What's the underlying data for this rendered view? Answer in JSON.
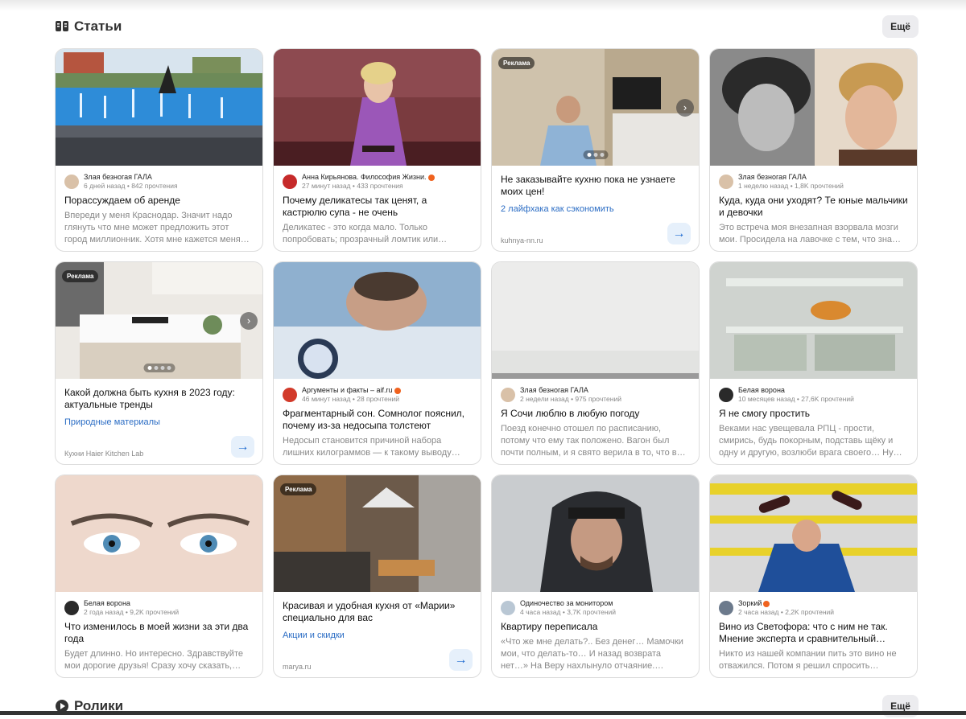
{
  "articles_section": {
    "title": "Статьи",
    "more_label": "Ещё"
  },
  "videos_section": {
    "title": "Ролики",
    "more_label": "Ещё"
  },
  "cards": [
    {
      "author": "Злая безногая ГАЛА",
      "stats": "6 дней назад • 842 прочтения",
      "title": "Порассуждаем об аренде",
      "snippet": "Впереди у меня Краснодар. Значит надо глянуть что мне может предложить этот город миллионник. Хотя мне кажется меня…"
    },
    {
      "author": "Анна Кирьянова. Философия Жизни.",
      "stats": "27 минут назад • 433 прочтения",
      "title": "Почему деликатесы так ценят, а кастрюлю супа - не очень",
      "snippet": "Деликатес - это когда мало. Только попробовать; прозрачный ломтик или…"
    },
    {
      "badge": "Реклама",
      "title": "Не заказывайте кухню пока не узнаете моих цен!",
      "link": "2 лайфхака как сэкономить",
      "domain": "kuhnya-nn.ru"
    },
    {
      "author": "Злая безногая ГАЛА",
      "stats": "1 неделю назад • 1,8K прочтений",
      "title": "Куда, куда они уходят? Те юные мальчики и девочки",
      "snippet": "Это встреча моя внезапная взорвала мозги мои. Просидела на лавочке с тем, что зна…"
    },
    {
      "badge": "Реклама",
      "title": "Какой должна быть кухня в 2023 году: актуальные тренды",
      "link": "Природные материалы",
      "domain": "Кухни Haier Kitchen Lab"
    },
    {
      "author": "Аргументы и факты – aif.ru",
      "stats": "46 минут назад • 28 прочтений",
      "title": "Фрагментарный сон. Сомнолог пояснил, почему из-за недосыпа толстеют",
      "snippet": "Недосып становится причиной набора лишних килограммов — к такому выводу…"
    },
    {
      "author": "Злая безногая ГАЛА",
      "stats": "2 недели назад • 975 прочтений",
      "title": "Я Сочи люблю в любую погоду",
      "snippet": "Поезд конечно отошел по расписанию, потому что ему так положено. Вагон был почти полным, и я свято верила в то, что в…"
    },
    {
      "author": "Белая ворона",
      "stats": "10 месяцев назад • 27,6K прочтений",
      "title": "Я не смогу простить",
      "snippet": "Веками нас увещевала РПЦ - прости, смирись, будь покорным, подставь щёку и одну и другую, возлюби врага своего… Ну…"
    },
    {
      "author": "Белая ворона",
      "stats": "2 года назад • 9,2K прочтений",
      "title": "Что изменилось в моей жизни за эти два года",
      "snippet": "Будет длинно. Но интересно. Здравствуйте мои дорогие друзья! Сразу хочу сказать, что…"
    },
    {
      "badge": "Реклама",
      "title": "Красивая и удобная кухня от «Марии» специально для вас",
      "link": "Акции и скидки",
      "domain": "marya.ru"
    },
    {
      "author": "Одиночество за монитором",
      "stats": "4 часа назад • 3,7K прочтений",
      "title": "Квартиру переписала",
      "snippet": "«Что же мне делать?.. Без денег… Мамочки мои, что делать-то… И назад возврата нет…» На Веру нахлынуло отчаяние. Большой…"
    },
    {
      "author": "Зоркий",
      "stats": "2 часа назад • 2,2K прочтений",
      "title": "Вино из Светофора: что с ним не так. Мнение эксперта и сравнительный…",
      "snippet": "Никто из нашей компании пить это вино не отважился. Потом я решил спросить…"
    }
  ],
  "colors": {
    "accent": "#2a6cc4",
    "verified": "#f0621e",
    "card_border": "#dcdcdc"
  }
}
